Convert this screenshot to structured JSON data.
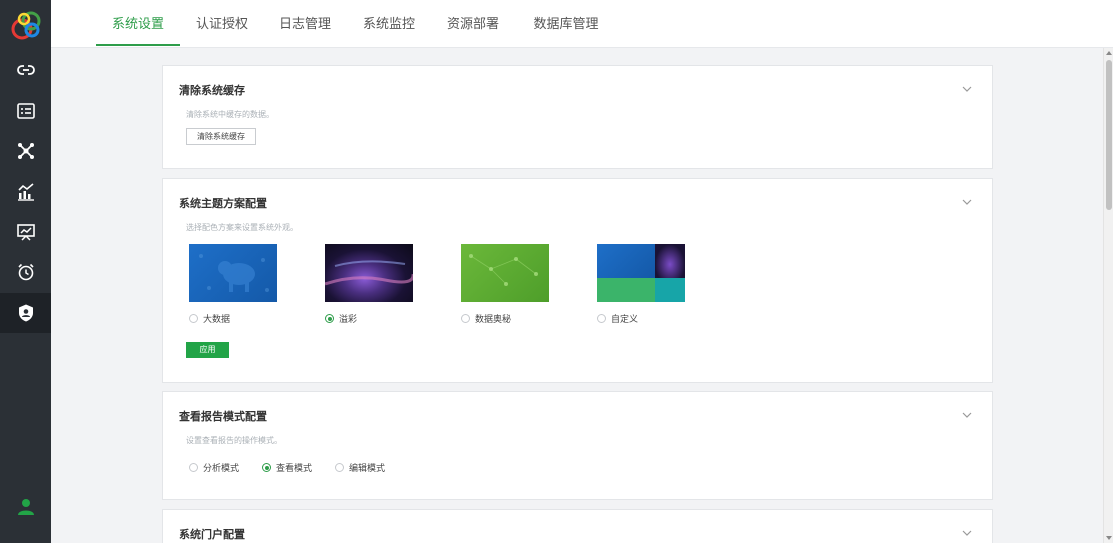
{
  "tabs": [
    {
      "label": "系统设置",
      "active": true
    },
    {
      "label": "认证授权"
    },
    {
      "label": "日志管理"
    },
    {
      "label": "系统监控"
    },
    {
      "label": "资源部署"
    },
    {
      "label": "数据库管理"
    }
  ],
  "sidebar": {
    "items": [
      {
        "icon": "link-icon"
      },
      {
        "icon": "list-card-icon"
      },
      {
        "icon": "network-icon"
      },
      {
        "icon": "analytics-chart-icon"
      },
      {
        "icon": "presentation-chart-icon"
      },
      {
        "icon": "alarm-clock-icon"
      },
      {
        "icon": "shield-user-icon",
        "active": true
      }
    ],
    "footer_icon": "user-icon"
  },
  "cards": {
    "cache": {
      "title": "清除系统缓存",
      "desc": "清除系统中缓存的数据。",
      "button": "清除系统缓存"
    },
    "theme": {
      "title": "系统主题方案配置",
      "desc": "选择配色方案来设置系统外观。",
      "options": [
        {
          "label": "大数据",
          "selected": false
        },
        {
          "label": "溢彩",
          "selected": true
        },
        {
          "label": "数据奥秘",
          "selected": false
        },
        {
          "label": "自定义",
          "selected": false
        }
      ],
      "apply": "应用"
    },
    "report": {
      "title": "查看报告模式配置",
      "desc": "设置查看报告的操作模式。",
      "options": [
        {
          "label": "分析模式",
          "selected": false
        },
        {
          "label": "查看模式",
          "selected": true
        },
        {
          "label": "编辑模式",
          "selected": false
        }
      ]
    },
    "portal": {
      "title": "系统门户配置"
    }
  },
  "colors": {
    "accent": "#2e9d4a",
    "sidebar": "#2b3036",
    "apply_button": "#22a447"
  }
}
